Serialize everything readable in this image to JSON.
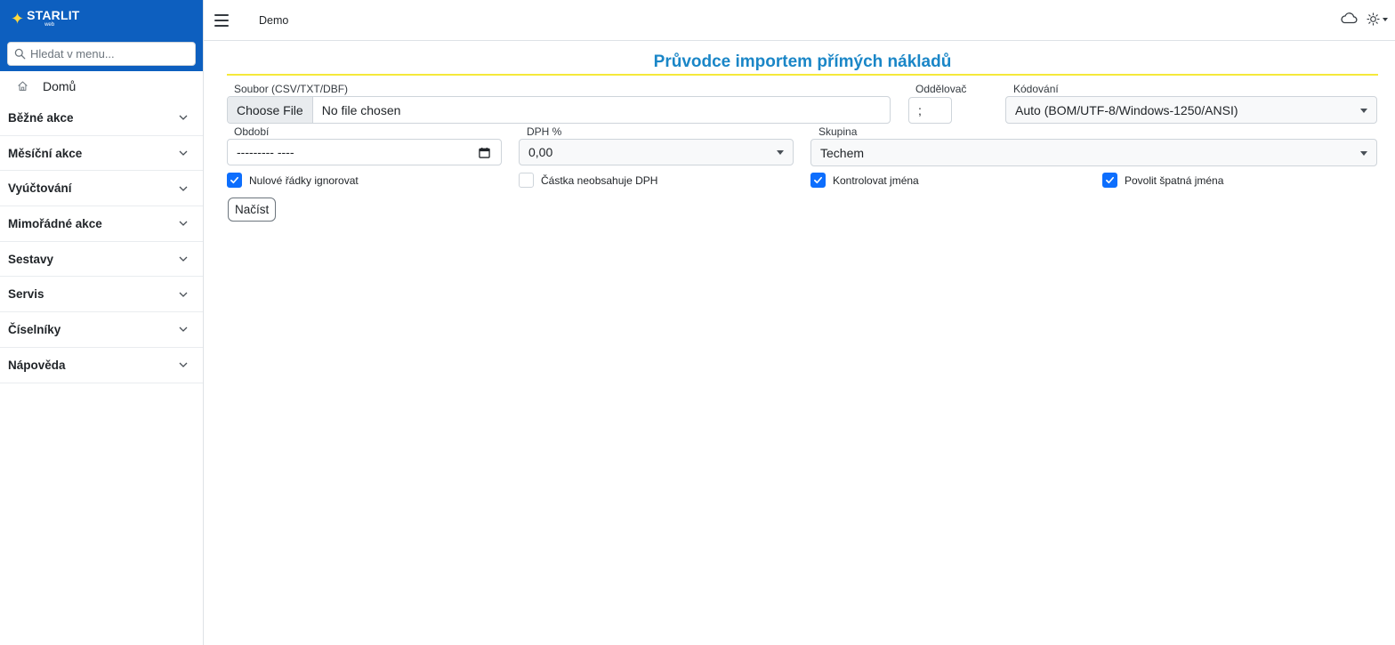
{
  "sidebar": {
    "brand": {
      "name": "STARLIT",
      "sub": "web"
    },
    "search_placeholder": "Hledat v menu...",
    "home_label": "Domů",
    "menu": [
      {
        "label": "Běžné akce"
      },
      {
        "label": "Měsíční akce"
      },
      {
        "label": "Vyúčtování"
      },
      {
        "label": "Mimořádné akce"
      },
      {
        "label": "Sestavy"
      },
      {
        "label": "Servis"
      },
      {
        "label": "Číselníky"
      },
      {
        "label": "Nápověda"
      }
    ]
  },
  "topbar": {
    "title": "Demo"
  },
  "main": {
    "title": "Průvodce importem přímých nákladů",
    "file": {
      "label": "Soubor (CSV/TXT/DBF)",
      "button": "Choose File",
      "status": "No file chosen"
    },
    "separator": {
      "label": "Oddělovač",
      "value": ";"
    },
    "encoding": {
      "label": "Kódování",
      "value": "Auto (BOM/UTF-8/Windows-1250/ANSI)"
    },
    "period": {
      "label": "Období",
      "value": "--------- ----"
    },
    "vat": {
      "label": "DPH %",
      "value": "0,00"
    },
    "group": {
      "label": "Skupina",
      "value": "Techem"
    },
    "checkboxes": [
      {
        "label": "Nulové řádky ignorovat",
        "checked": true
      },
      {
        "label": "Částka neobsahuje DPH",
        "checked": false
      },
      {
        "label": "Kontrolovat jména",
        "checked": true
      },
      {
        "label": "Povolit špatná jména",
        "checked": true
      }
    ],
    "load_button": "Načíst"
  },
  "colors": {
    "brand": "#0d5fbf",
    "title": "#1a86c7",
    "title_underline": "#f5e93b",
    "checkbox_checked": "#0d6efd"
  }
}
